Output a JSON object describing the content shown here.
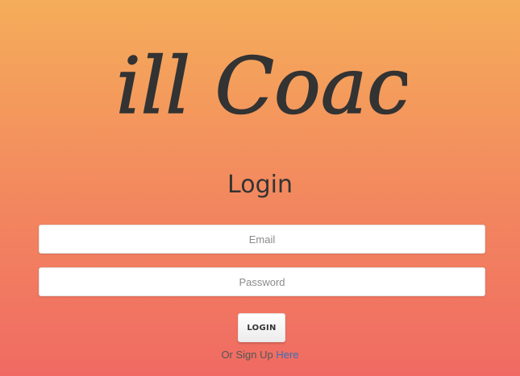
{
  "brand": {
    "logo_text": "Pill Coach"
  },
  "login": {
    "title": "Login",
    "email_placeholder": "Email",
    "password_placeholder": "Password",
    "button_label": "LOGIN",
    "signup_prefix": "Or Sign Up",
    "signup_link": "Here"
  },
  "colors": {
    "gradient_top": "#f5ad5a",
    "gradient_bottom": "#f06a63",
    "text_dark": "#333333",
    "link": "#3a6fb5"
  }
}
